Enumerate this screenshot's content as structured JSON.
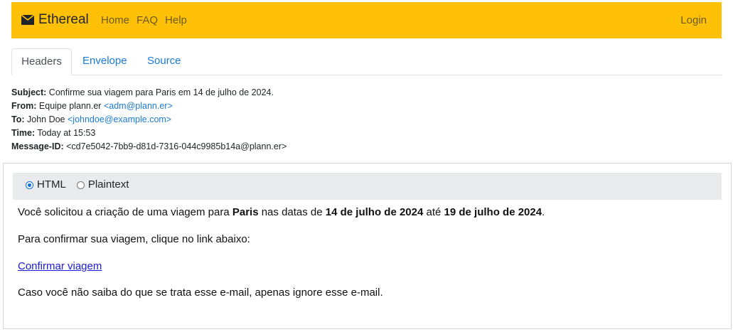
{
  "navbar": {
    "brand": "Ethereal",
    "links": [
      "Home",
      "FAQ",
      "Help"
    ],
    "login": "Login",
    "bg_color": "#ffc107"
  },
  "tabs": [
    "Headers",
    "Envelope",
    "Source"
  ],
  "headers": {
    "subject_label": "Subject:",
    "subject": "Confirme sua viagem para Paris em 14 de julho de 2024.",
    "from_label": "From:",
    "from_name": "Equipe plann.er",
    "from_email": "<adm@plann.er>",
    "to_label": "To:",
    "to_name": "John Doe",
    "to_email": "<johndoe@example.com>",
    "time_label": "Time:",
    "time": "Today at 15:53",
    "msgid_label": "Message-ID:",
    "msgid": "<cd7e5042-7bb9-d81d-7316-044c9985b14a@plann.er>"
  },
  "view_toggle": {
    "options": [
      "HTML",
      "Plaintext"
    ],
    "selected": "HTML"
  },
  "body": {
    "p1_a": "Você solicitou a criação de uma viagem para ",
    "p1_city": "Paris",
    "p1_b": " nas datas de ",
    "p1_start": "14 de julho de 2024",
    "p1_c": " até ",
    "p1_end": "19 de julho de 2024",
    "p1_d": ".",
    "p2": "Para confirmar sua viagem, clique no link abaixo:",
    "link": "Confirmar viagem",
    "p3": "Caso você não saiba do que se trata esse e-mail, apenas ignore esse e-mail."
  }
}
